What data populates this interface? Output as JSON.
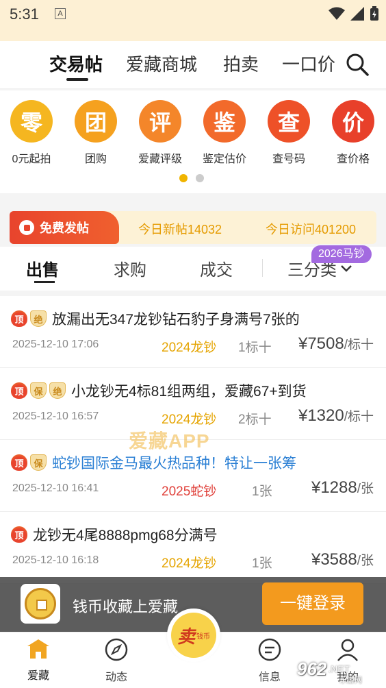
{
  "status_bar": {
    "time": "5:31",
    "notif_icon": "A"
  },
  "top_tabs": {
    "items": [
      "交易帖",
      "爱藏商城",
      "拍卖",
      "一口价"
    ],
    "active": "交易帖",
    "search_icon": "search-icon"
  },
  "quick_entries": [
    {
      "glyph": "零",
      "label": "0元起拍",
      "color": "#f5b620"
    },
    {
      "glyph": "团",
      "label": "团购",
      "color": "#f5a11f"
    },
    {
      "glyph": "评",
      "label": "爱藏评级",
      "color": "#f4862a"
    },
    {
      "glyph": "鉴",
      "label": "鉴定估价",
      "color": "#f26a2b"
    },
    {
      "glyph": "查",
      "label": "查号码",
      "color": "#ee5128"
    },
    {
      "glyph": "价",
      "label": "查价格",
      "color": "#e8402a"
    }
  ],
  "banner": {
    "post_button": "免费发帖",
    "today_new": "今日新帖14032",
    "today_visits": "今日访问401200"
  },
  "sub_tabs": {
    "items": [
      "出售",
      "求购",
      "成交"
    ],
    "active": "出售",
    "filter": "三分类",
    "badge": "2026马钞"
  },
  "listings": [
    {
      "tags": [
        "顶",
        "绝"
      ],
      "title": "放漏出无347龙钞钻石豹子身满号7张的",
      "title_color": "#222222",
      "date": "2025-12-10 17:06",
      "category": "2024龙钞",
      "category_color": "#e5a400",
      "qty": "1标十",
      "price": "¥7508",
      "unit": "/标十"
    },
    {
      "tags": [
        "顶",
        "保",
        "绝"
      ],
      "title": "小龙钞无4标81组两组，爱藏67+到货",
      "title_color": "#222222",
      "date": "2025-12-10 16:57",
      "category": "2024龙钞",
      "category_color": "#e5a400",
      "qty": "2标十",
      "price": "¥1320",
      "unit": "/标十"
    },
    {
      "tags": [
        "顶",
        "保"
      ],
      "title": "蛇钞国际金马最火热品种！特让一张筹",
      "title_color": "#2a7fd4",
      "date": "2025-12-10 16:41",
      "category": "2025蛇钞",
      "category_color": "#e0403a",
      "qty": "1张",
      "price": "¥1288",
      "unit": "/张"
    },
    {
      "tags": [
        "顶"
      ],
      "title": "龙钞无4尾8888pmg68分满号",
      "title_color": "#222222",
      "date": "2025-12-10 16:18",
      "category": "2024龙钞",
      "category_color": "#e5a400",
      "qty": "1张",
      "price": "¥3588",
      "unit": "/张"
    }
  ],
  "watermark": "爱藏APP",
  "login_bar": {
    "text": "钱币收藏上爱藏",
    "button": "一键登录"
  },
  "bottom_nav": [
    {
      "label": "爱藏",
      "icon": "home-icon"
    },
    {
      "label": "动态",
      "icon": "compass-icon"
    },
    {
      "label": "信息",
      "icon": "message-icon"
    },
    {
      "label": "我的",
      "icon": "user-icon"
    }
  ],
  "sell_button": {
    "main": "卖",
    "sub": "钱币"
  },
  "site_watermark": {
    "num": "962",
    "net": ".NET",
    "sub": "乐游网"
  }
}
